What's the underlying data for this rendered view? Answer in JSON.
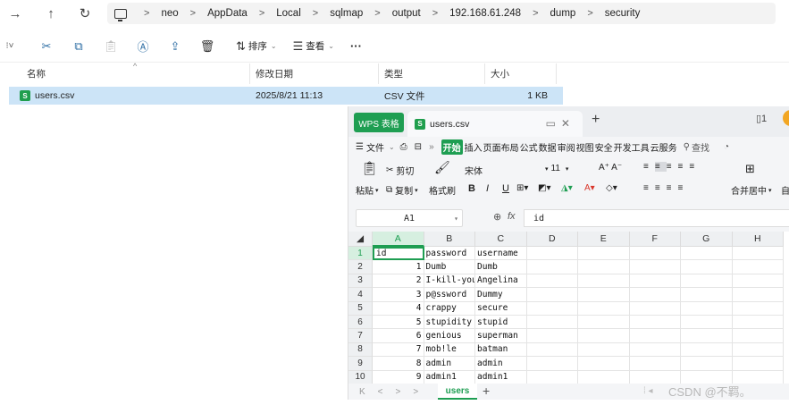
{
  "address_bar": {
    "nav_forward": "→",
    "nav_up": "↑",
    "nav_refresh": "↻",
    "crumbs": [
      "neo",
      "AppData",
      "Local",
      "sqlmap",
      "output",
      "192.168.61.248",
      "dump",
      "security"
    ],
    "separator": ">"
  },
  "toolbar": {
    "sort_label": "排序",
    "view_label": "查看",
    "more_label": "···"
  },
  "file_list": {
    "columns": [
      "名称",
      "修改日期",
      "类型",
      "大小"
    ],
    "sort_caret": "^",
    "rows": [
      {
        "name": "users.csv",
        "modified": "2025/8/21 11:13",
        "type": "CSV 文件",
        "size": "1 KB"
      }
    ]
  },
  "wps": {
    "brand": "WPS 表格",
    "file_tab": "users.csv",
    "menu": {
      "file": "文件",
      "active": "开始",
      "items": [
        "插入",
        "页面布局",
        "公式",
        "数据",
        "审阅",
        "视图",
        "安全",
        "开发工具",
        "云服务"
      ],
      "search": "查找"
    },
    "ribbon": {
      "paste": "粘贴",
      "cut": "剪切",
      "copy": "复制",
      "format_painter": "格式刷",
      "font_name": "宋体",
      "font_size": "11",
      "merge": "合并居中",
      "wrap": "自"
    },
    "formula_bar": {
      "name_box": "A1",
      "fx": "fx",
      "value": "id"
    },
    "columns": [
      "A",
      "B",
      "C",
      "D",
      "E",
      "F",
      "G",
      "H"
    ],
    "rows": [
      {
        "row": "1",
        "a": "id",
        "b": "password",
        "c": "username"
      },
      {
        "row": "2",
        "a": "1",
        "b": "Dumb",
        "c": "Dumb"
      },
      {
        "row": "3",
        "a": "2",
        "b": "I-kill-you",
        "c": "Angelina"
      },
      {
        "row": "4",
        "a": "3",
        "b": "p@ssword",
        "c": "Dummy"
      },
      {
        "row": "5",
        "a": "4",
        "b": "crappy",
        "c": "secure"
      },
      {
        "row": "6",
        "a": "5",
        "b": "stupidity",
        "c": "stupid"
      },
      {
        "row": "7",
        "a": "6",
        "b": "genious",
        "c": "superman"
      },
      {
        "row": "8",
        "a": "7",
        "b": "mob!le",
        "c": "batman"
      },
      {
        "row": "9",
        "a": "8",
        "b": "admin",
        "c": "admin"
      },
      {
        "row": "10",
        "a": "9",
        "b": "admin1",
        "c": "admin1"
      }
    ],
    "sheet_tab": "users",
    "colors": {
      "accent": "#1e9e52",
      "selection": "#cce4f7"
    }
  },
  "watermark": "CSDN @不羁。"
}
